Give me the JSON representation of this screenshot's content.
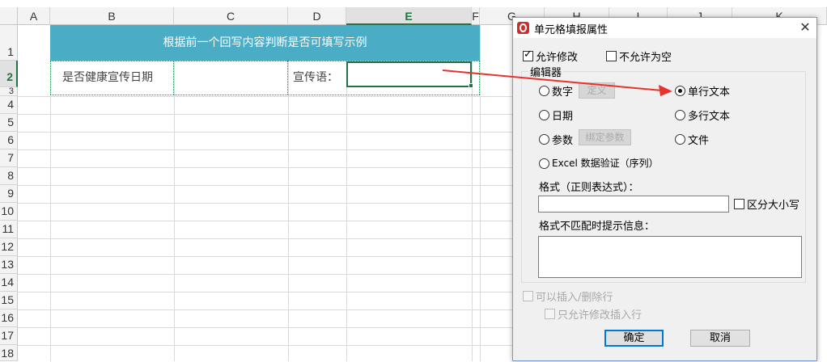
{
  "sheet": {
    "columns": [
      "A",
      "B",
      "C",
      "D",
      "E",
      "F",
      "G",
      "H",
      "I",
      "J",
      "K"
    ],
    "rows": [
      "1",
      "2",
      "3",
      "4",
      "5",
      "6",
      "7",
      "8",
      "9",
      "10",
      "11",
      "12",
      "13",
      "14",
      "15",
      "16",
      "17",
      "18"
    ],
    "selected_column": "E",
    "selected_row": "2",
    "title": "根据前一个回写内容判断是否可填写示例",
    "b2": "是否健康宣传日期",
    "d2": "宣传语：",
    "e2": "",
    "accent_color": "#4bacc6"
  },
  "dialog": {
    "title": "单元格填报属性",
    "close": "✕",
    "allow_edit": {
      "label": "允许修改",
      "checked": true
    },
    "not_empty": {
      "label": "不允许为空",
      "checked": false
    },
    "editor_group": "编辑器",
    "editors": {
      "number": {
        "label": "数字",
        "button": "定义",
        "selected": false
      },
      "single_text": {
        "label": "单行文本",
        "selected": true
      },
      "date": {
        "label": "日期",
        "selected": false
      },
      "multi_text": {
        "label": "多行文本",
        "selected": false
      },
      "param": {
        "label": "参数",
        "button": "绑定参数",
        "selected": false
      },
      "file": {
        "label": "文件",
        "selected": false
      },
      "excel": {
        "label": "Excel 数据验证（序列）",
        "selected": false
      }
    },
    "format_label": "格式（正则表达式）：",
    "format_value": "",
    "case_sensitive": {
      "label": "区分大小写",
      "checked": false
    },
    "mismatch_label": "格式不匹配时提示信息：",
    "mismatch_value": "",
    "insert_delete": {
      "label": "可以插入/删除行",
      "checked": false
    },
    "only_edit_inserted": {
      "label": "只允许修改插入行",
      "checked": false
    },
    "ok": "确定",
    "cancel": "取消"
  }
}
